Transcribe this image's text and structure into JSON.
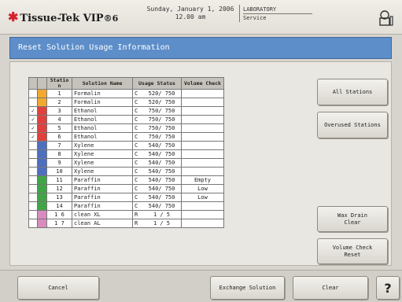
{
  "header": {
    "logo_text": "Tissue-Tek",
    "logo_model": "VIP",
    "logo_version": "®6",
    "date": "Sunday, January 1, 2006",
    "time": "12.00 am",
    "role_line1": "LABORATORY",
    "role_line2": "Service"
  },
  "title": "Reset Solution Usage Information",
  "table": {
    "headers": {
      "station": "Statio\nn",
      "name": "Solution Name",
      "usage": "Usage Status",
      "volume": "Volume Check"
    },
    "rows": [
      {
        "check": "",
        "color": "#f2a92e",
        "num": "1",
        "name": "Formalin",
        "code": "C",
        "usage": "520/ 750",
        "volume": ""
      },
      {
        "check": "",
        "color": "#f2a92e",
        "num": "2",
        "name": "Formalin",
        "code": "C",
        "usage": "520/ 750",
        "volume": ""
      },
      {
        "check": "✓",
        "color": "#e0413d",
        "num": "3",
        "name": "Ethanol",
        "code": "C",
        "usage": "750/ 750",
        "volume": ""
      },
      {
        "check": "✓",
        "color": "#e0413d",
        "num": "4",
        "name": "Ethanol",
        "code": "C",
        "usage": "750/ 750",
        "volume": ""
      },
      {
        "check": "✓",
        "color": "#e0413d",
        "num": "5",
        "name": "Ethanol",
        "code": "C",
        "usage": "750/ 750",
        "volume": ""
      },
      {
        "check": "✓",
        "color": "#e0413d",
        "num": "6",
        "name": "Ethanol",
        "code": "C",
        "usage": "750/ 750",
        "volume": ""
      },
      {
        "check": "",
        "color": "#4d6fc0",
        "num": "7",
        "name": "Xylene",
        "code": "C",
        "usage": "540/ 750",
        "volume": ""
      },
      {
        "check": "",
        "color": "#4d6fc0",
        "num": "8",
        "name": "Xylene",
        "code": "C",
        "usage": "540/ 750",
        "volume": ""
      },
      {
        "check": "",
        "color": "#4d6fc0",
        "num": "9",
        "name": "Xylene",
        "code": "C",
        "usage": "540/ 750",
        "volume": ""
      },
      {
        "check": "",
        "color": "#4d6fc0",
        "num": "10",
        "name": "Xylene",
        "code": "C",
        "usage": "540/ 750",
        "volume": ""
      },
      {
        "check": "",
        "color": "#3fa546",
        "num": "11",
        "name": "Paraffin",
        "code": "C",
        "usage": "540/ 750",
        "volume": "Empty"
      },
      {
        "check": "",
        "color": "#3fa546",
        "num": "12",
        "name": "Paraffin",
        "code": "C",
        "usage": "540/ 750",
        "volume": "Low"
      },
      {
        "check": "",
        "color": "#3fa546",
        "num": "13",
        "name": "Paraffin",
        "code": "C",
        "usage": "540/ 750",
        "volume": "Low"
      },
      {
        "check": "",
        "color": "#3fa546",
        "num": "14",
        "name": "Paraffin",
        "code": "C",
        "usage": "540/ 750",
        "volume": ""
      },
      {
        "check": "",
        "color": "#d98cc0",
        "num": "1 6",
        "name": "clean XL",
        "code": "R",
        "usage": "1 / 5",
        "volume": ""
      },
      {
        "check": "",
        "color": "#d98cc0",
        "num": "1 7",
        "name": "clean AL",
        "code": "R",
        "usage": "1 / 5",
        "volume": ""
      }
    ]
  },
  "buttons": {
    "all_stations": "All Stations",
    "overused_stations": "Overused Stations",
    "wax_drain_clear": "Wax Drain\nClear",
    "volume_check_reset": "Volume Check\nReset",
    "cancel": "Cancel",
    "exchange_solution": "Exchange Solution",
    "clear": "Clear",
    "help": "?"
  }
}
